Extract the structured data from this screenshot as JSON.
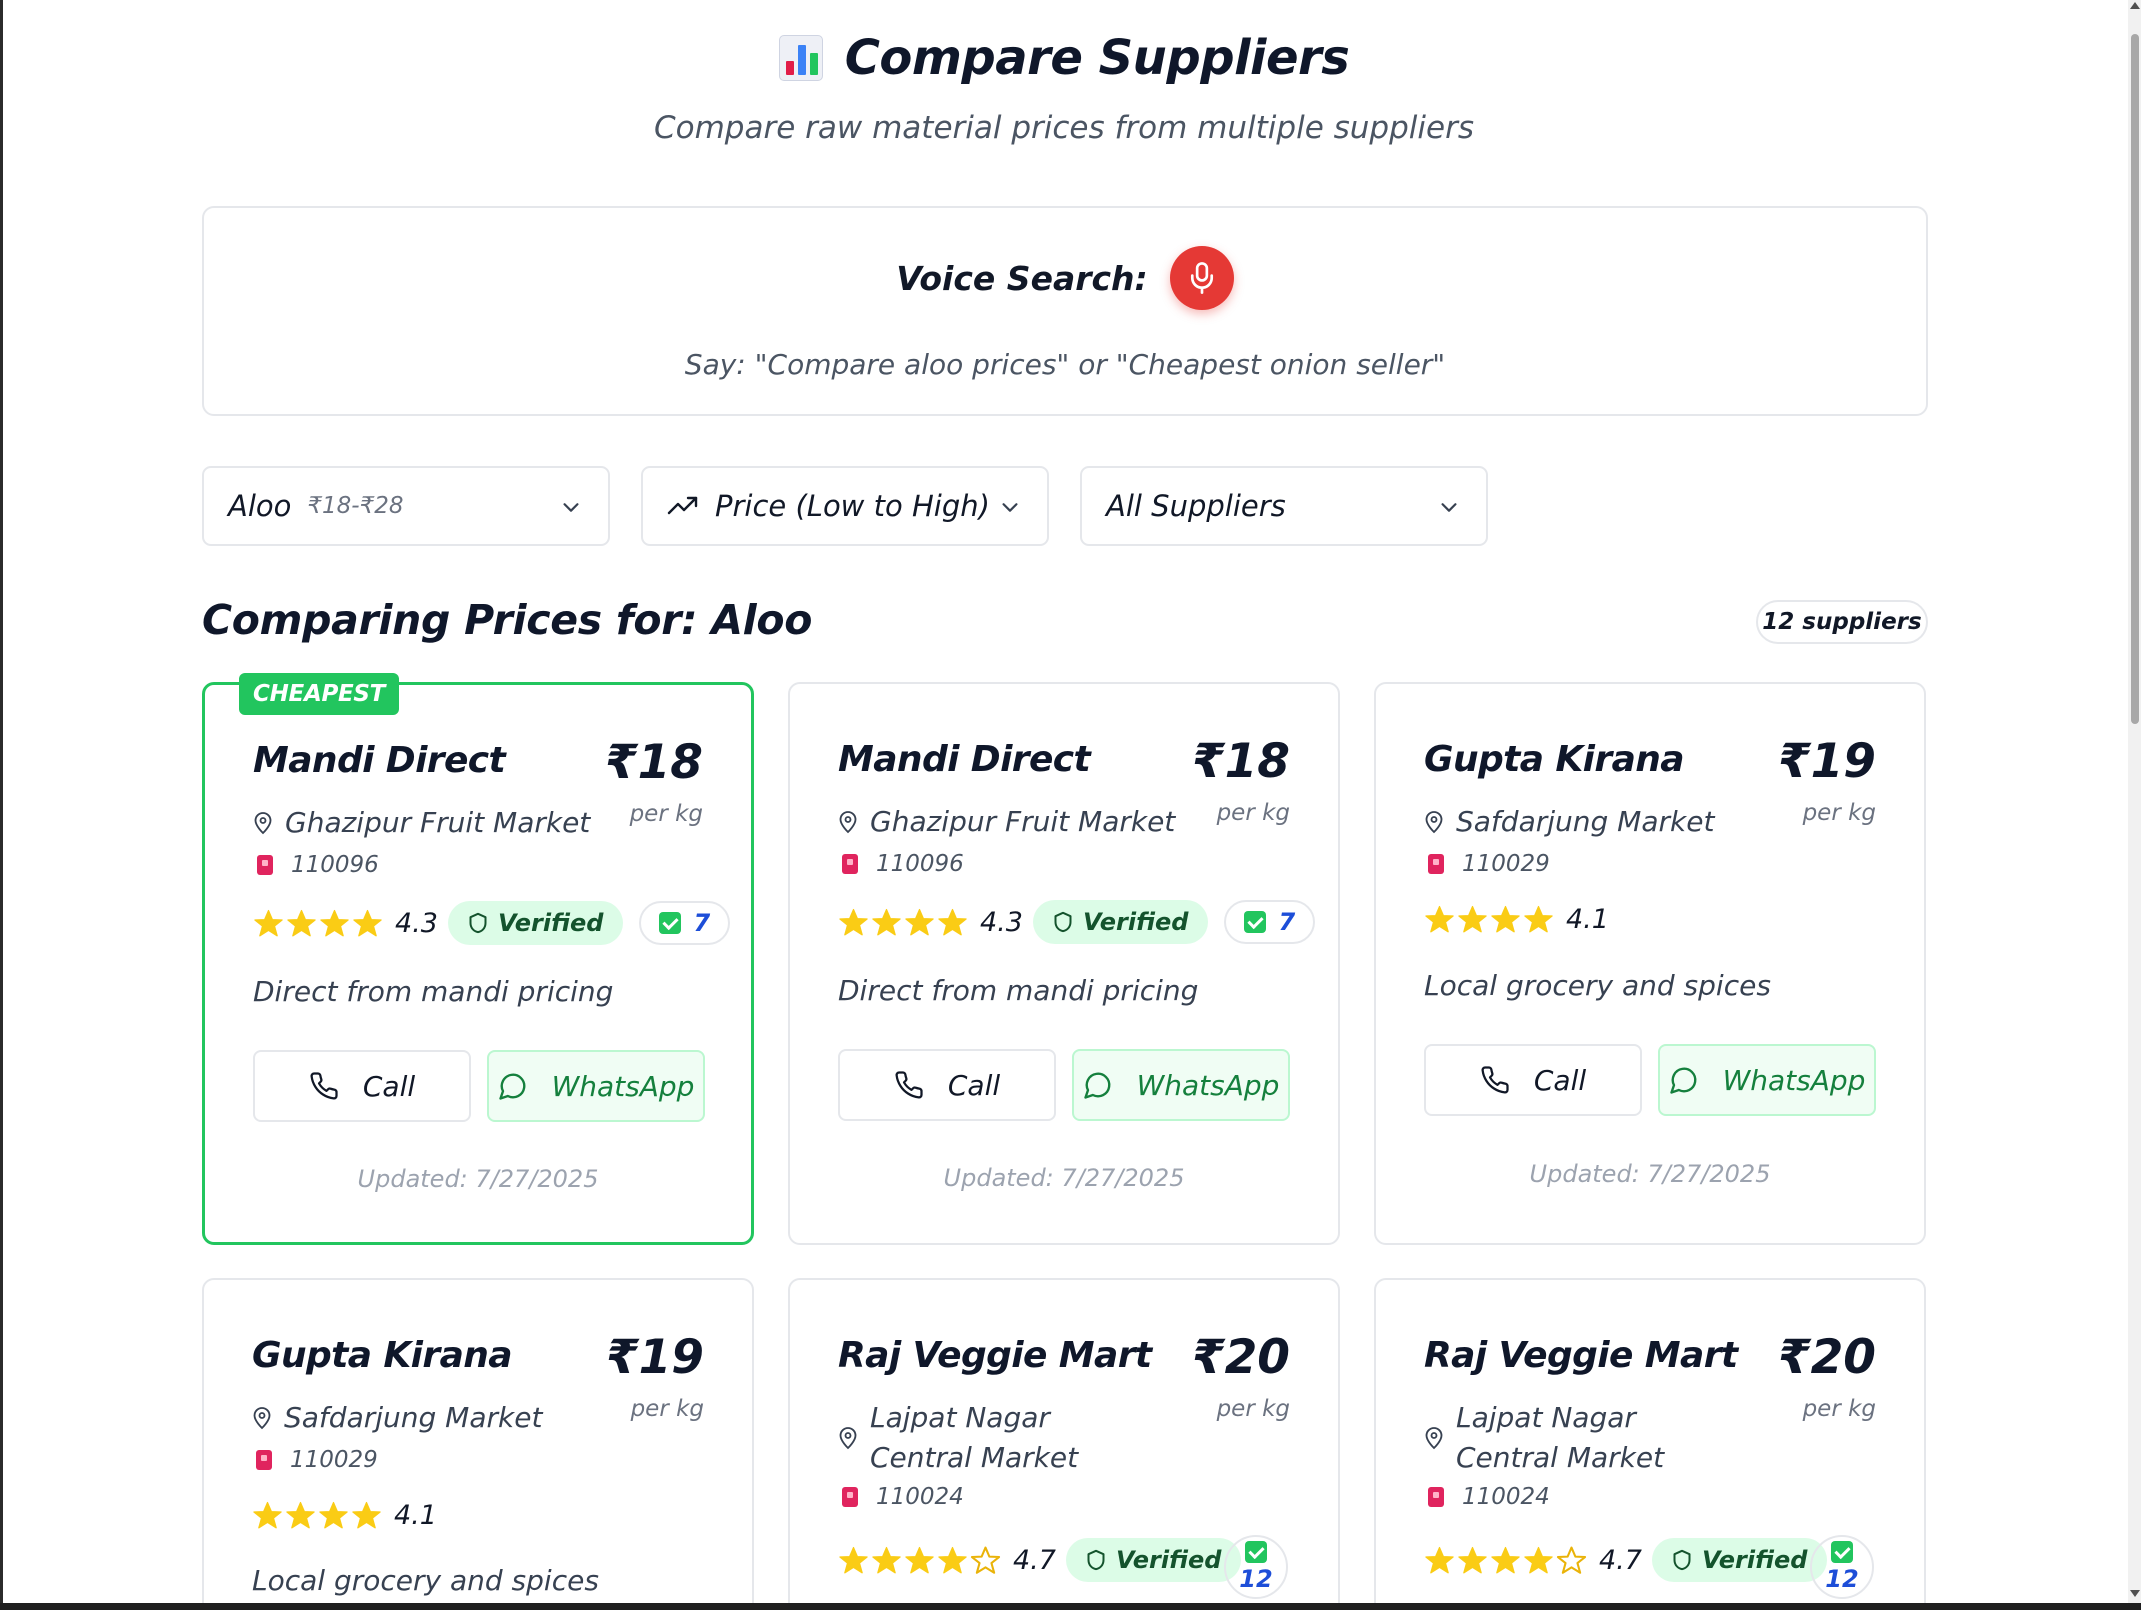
{
  "header": {
    "title": "Compare Suppliers",
    "subtitle": "Compare raw material prices from multiple suppliers"
  },
  "voice": {
    "label": "Voice Search:",
    "hint": "Say: \"Compare aloo prices\" or \"Cheapest onion seller\""
  },
  "filters": {
    "item": "Aloo",
    "item_range": "₹18-₹28",
    "sort": "Price (Low to High)",
    "suppliers": "All Suppliers"
  },
  "section": {
    "title": "Comparing Prices for: Aloo",
    "count": "12 suppliers"
  },
  "colors": {
    "accent_green": "#22c55e",
    "mic_red": "#e53935",
    "star_yellow": "#facc15",
    "checks_blue": "#1d4ed8"
  },
  "cheapest_tag": "CHEAPEST",
  "call_label": "Call",
  "whatsapp_label": "WhatsApp",
  "per_unit": "per kg",
  "verified_label": "Verified",
  "cards": [
    {
      "name": "Mandi Direct",
      "price": "₹18",
      "market": "Ghazipur Fruit Market",
      "pincode": "110096",
      "rating": "4.3",
      "stars": 4,
      "verified": true,
      "checks": "7",
      "description": "Direct from mandi pricing",
      "updated": "Updated: 7/27/2025"
    },
    {
      "name": "Mandi Direct",
      "price": "₹18",
      "market": "Ghazipur Fruit Market",
      "pincode": "110096",
      "rating": "4.3",
      "stars": 4,
      "verified": true,
      "checks": "7",
      "description": "Direct from mandi pricing",
      "updated": "Updated: 7/27/2025"
    },
    {
      "name": "Gupta Kirana",
      "price": "₹19",
      "market": "Safdarjung Market",
      "pincode": "110029",
      "rating": "4.1",
      "stars": 4,
      "verified": false,
      "description": "Local grocery and spices",
      "updated": "Updated: 7/27/2025"
    },
    {
      "name": "Gupta Kirana",
      "price": "₹19",
      "market": "Safdarjung Market",
      "pincode": "110029",
      "rating": "4.1",
      "stars": 4,
      "verified": false,
      "description": "Local grocery and spices"
    },
    {
      "name": "Raj Veggie Mart",
      "price": "₹20",
      "market": "Lajpat Nagar Central Market",
      "pincode": "110024",
      "rating": "4.7",
      "stars": 4,
      "verified": true,
      "checks": "12"
    },
    {
      "name": "Raj Veggie Mart",
      "price": "₹20",
      "market": "Lajpat Nagar Central Market",
      "pincode": "110024",
      "rating": "4.7",
      "stars": 4,
      "verified": true,
      "checks": "12"
    }
  ]
}
